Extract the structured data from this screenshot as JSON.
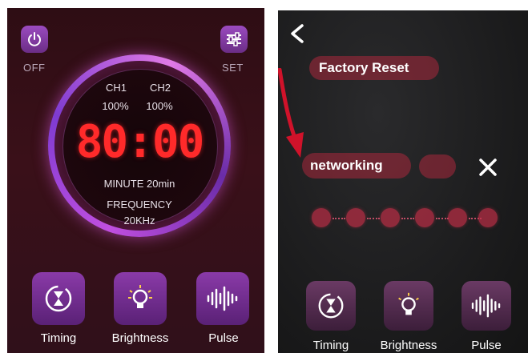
{
  "left": {
    "power": {
      "label": "OFF"
    },
    "settings": {
      "label": "SET"
    },
    "dial": {
      "ch1_label": "CH1",
      "ch1_value": "100%",
      "ch2_label": "CH2",
      "ch2_value": "100%",
      "time": "80:00",
      "minute_line": "MINUTE  20min",
      "frequency_label": "FREQUENCY",
      "frequency_value": "20KHz"
    },
    "features": [
      {
        "label": "Timing",
        "icon": "timer-hourglass-icon"
      },
      {
        "label": "Brightness",
        "icon": "lightbulb-icon"
      },
      {
        "label": "Pulse",
        "icon": "waveform-icon"
      }
    ]
  },
  "right": {
    "back_icon": "chevron-left-icon",
    "factory_reset": "Factory Reset",
    "networking": "networking",
    "close_icon": "close-icon",
    "features": [
      {
        "label": "Timing",
        "icon": "timer-hourglass-icon"
      },
      {
        "label": "Brightness",
        "icon": "lightbulb-icon"
      },
      {
        "label": "Pulse",
        "icon": "waveform-icon"
      }
    ]
  },
  "colors": {
    "accent_purple": "#9b4bc0",
    "display_red": "#ff2a2a",
    "pill_red": "#aa283c",
    "arrow_red": "#d0122a"
  }
}
